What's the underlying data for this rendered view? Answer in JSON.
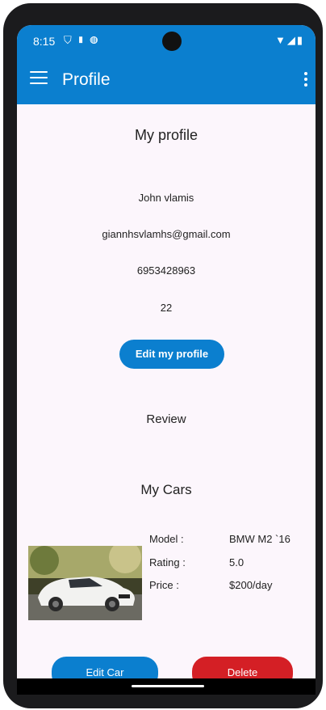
{
  "status": {
    "time": "8:15"
  },
  "appbar": {
    "title": "Profile"
  },
  "profile": {
    "heading": "My profile",
    "name": "John vlamis",
    "email": "giannhsvlamhs@gmail.com",
    "phone": "6953428963",
    "age": "22",
    "edit_label": "Edit my profile"
  },
  "review": {
    "label": "Review"
  },
  "cars": {
    "heading": "My Cars",
    "items": [
      {
        "model_label": "Model :",
        "model_value": "BMW M2 `16",
        "rating_label": "Rating :",
        "rating_value": "5.0",
        "price_label": "Price :",
        "price_value": "$200/day"
      }
    ],
    "edit_label": "Edit Car",
    "delete_label": "Delete"
  },
  "colors": {
    "primary": "#0b7fcf",
    "danger": "#d41f25",
    "background": "#fcf6fc"
  },
  "icons": [
    "shield-icon",
    "sim-card-icon",
    "app-notification-icon",
    "wifi-icon",
    "signal-icon",
    "battery-icon",
    "menu-icon",
    "more-vert-icon"
  ]
}
